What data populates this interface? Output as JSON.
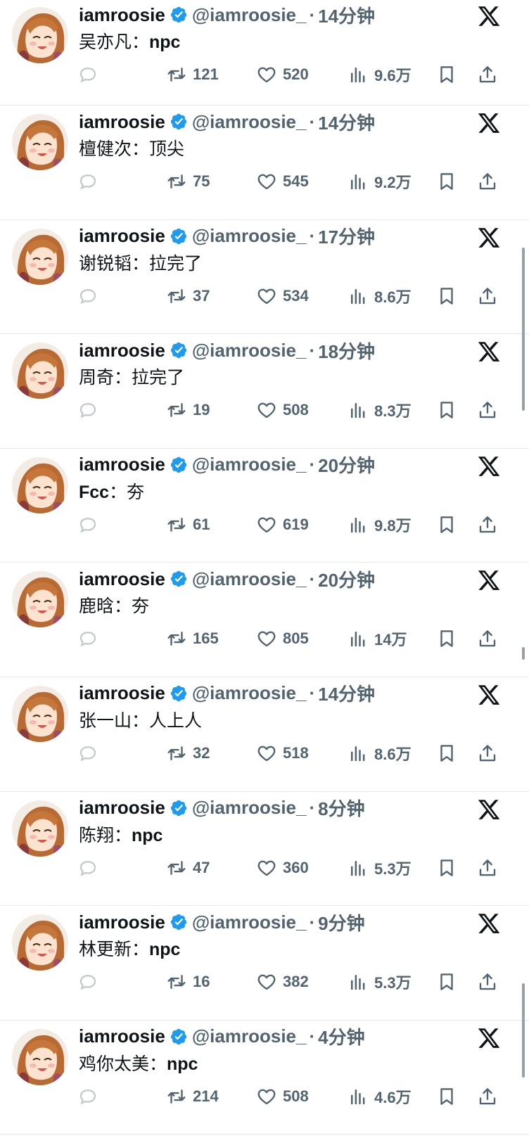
{
  "colors": {
    "accent": "#1d9bf0",
    "secondary_text": "#536471",
    "primary_text": "#0f1419",
    "divider": "#e6e9ec"
  },
  "icons": {
    "verified": "verified-badge-icon",
    "x_logo": "x-logo-icon",
    "reply": "reply-icon",
    "retweet": "retweet-icon",
    "like": "heart-icon",
    "views": "views-icon",
    "bookmark": "bookmark-icon",
    "share": "share-icon"
  },
  "tweets": [
    {
      "name": "iamroosie",
      "handle": "@iamroosie_",
      "sep": "·",
      "time": "14分钟",
      "text_prefix": "吴亦凡：",
      "text_latin": "npc",
      "text_rest": "",
      "retweets": "121",
      "likes": "520",
      "views": "9.6万"
    },
    {
      "name": "iamroosie",
      "handle": "@iamroosie_",
      "sep": "·",
      "time": "14分钟",
      "text_prefix": "檀健次：顶尖",
      "text_latin": "",
      "text_rest": "",
      "retweets": "75",
      "likes": "545",
      "views": "9.2万"
    },
    {
      "name": "iamroosie",
      "handle": "@iamroosie_",
      "sep": "·",
      "time": "17分钟",
      "text_prefix": "谢锐韬：拉完了",
      "text_latin": "",
      "text_rest": "",
      "retweets": "37",
      "likes": "534",
      "views": "8.6万"
    },
    {
      "name": "iamroosie",
      "handle": "@iamroosie_",
      "sep": "·",
      "time": "18分钟",
      "text_prefix": "周奇：拉完了",
      "text_latin": "",
      "text_rest": "",
      "retweets": "19",
      "likes": "508",
      "views": "8.3万"
    },
    {
      "name": "iamroosie",
      "handle": "@iamroosie_",
      "sep": "·",
      "time": "20分钟",
      "text_prefix": "",
      "text_latin": "Fcc",
      "text_rest": "：夯",
      "retweets": "61",
      "likes": "619",
      "views": "9.8万"
    },
    {
      "name": "iamroosie",
      "handle": "@iamroosie_",
      "sep": "·",
      "time": "20分钟",
      "text_prefix": "鹿晗：夯",
      "text_latin": "",
      "text_rest": "",
      "retweets": "165",
      "likes": "805",
      "views": "14万"
    },
    {
      "name": "iamroosie",
      "handle": "@iamroosie_",
      "sep": "·",
      "time": "14分钟",
      "text_prefix": "张一山：人上人",
      "text_latin": "",
      "text_rest": "",
      "retweets": "32",
      "likes": "518",
      "views": "8.6万"
    },
    {
      "name": "iamroosie",
      "handle": "@iamroosie_",
      "sep": "·",
      "time": "8分钟",
      "text_prefix": "陈翔：",
      "text_latin": "npc",
      "text_rest": "",
      "retweets": "47",
      "likes": "360",
      "views": "5.3万"
    },
    {
      "name": "iamroosie",
      "handle": "@iamroosie_",
      "sep": "·",
      "time": "9分钟",
      "text_prefix": "林更新：",
      "text_latin": "npc",
      "text_rest": "",
      "retweets": "16",
      "likes": "382",
      "views": "5.3万"
    },
    {
      "name": "iamroosie",
      "handle": "@iamroosie_",
      "sep": "·",
      "time": "4分钟",
      "text_prefix": "鸡你太美：",
      "text_latin": "npc",
      "text_rest": "",
      "retweets": "214",
      "likes": "508",
      "views": "4.6万"
    }
  ]
}
